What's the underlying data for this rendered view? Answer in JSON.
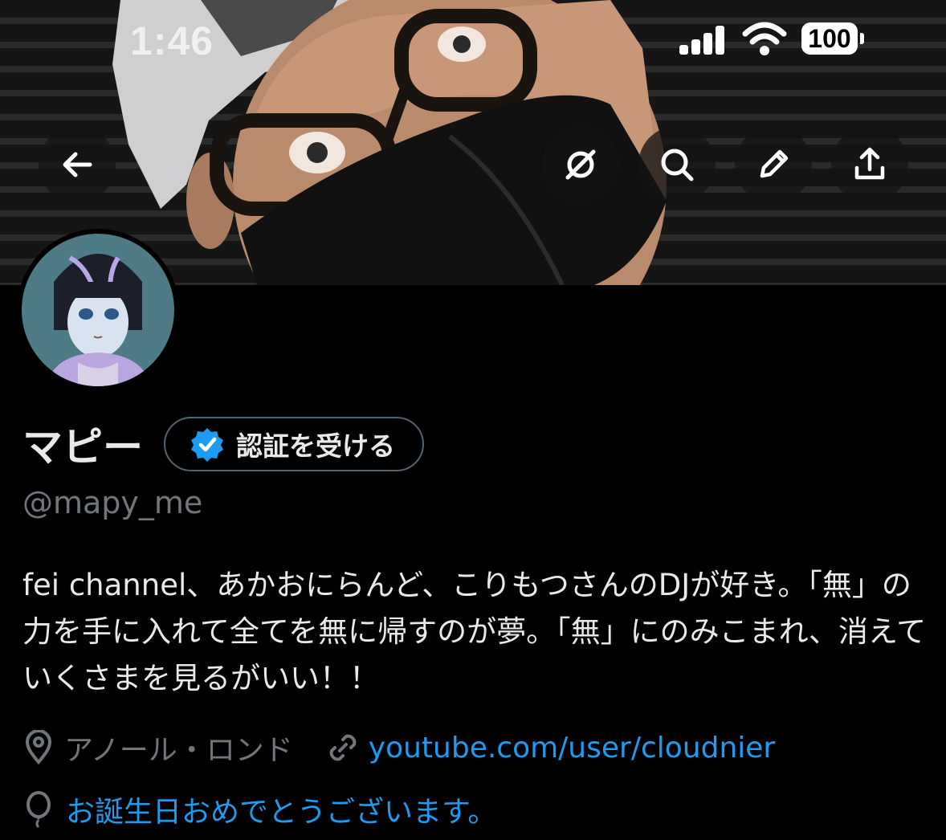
{
  "status_bar": {
    "time": "1:46",
    "battery": "100",
    "signal_icon": "cellular-signal-icon",
    "wifi_icon": "wifi-icon"
  },
  "nav": {
    "back_icon": "arrow-left-icon",
    "grok_icon": "slashed-circle-icon",
    "search_icon": "search-icon",
    "edit_icon": "pencil-icon",
    "share_icon": "share-icon"
  },
  "profile": {
    "display_name": "マピー",
    "verify_button_label": "認証を受ける",
    "handle": "@mapy_me",
    "bio": "fei channel、あかおにらんど、こりもつさんのDJが好き。「無」の力を手に入れて全てを無に帰すのが夢。「無」にのみこまれ、消えていくさまを見るがいい！！",
    "location": "アノール・ロンド",
    "link": "youtube.com/user/cloudnier",
    "birthday": "お誕生日おめでとうございます。"
  },
  "colors": {
    "background": "#000000",
    "text": "#e7e9ea",
    "muted": "#71767b",
    "link": "#1d9bf0",
    "verified_badge": "#1d9bf0"
  }
}
